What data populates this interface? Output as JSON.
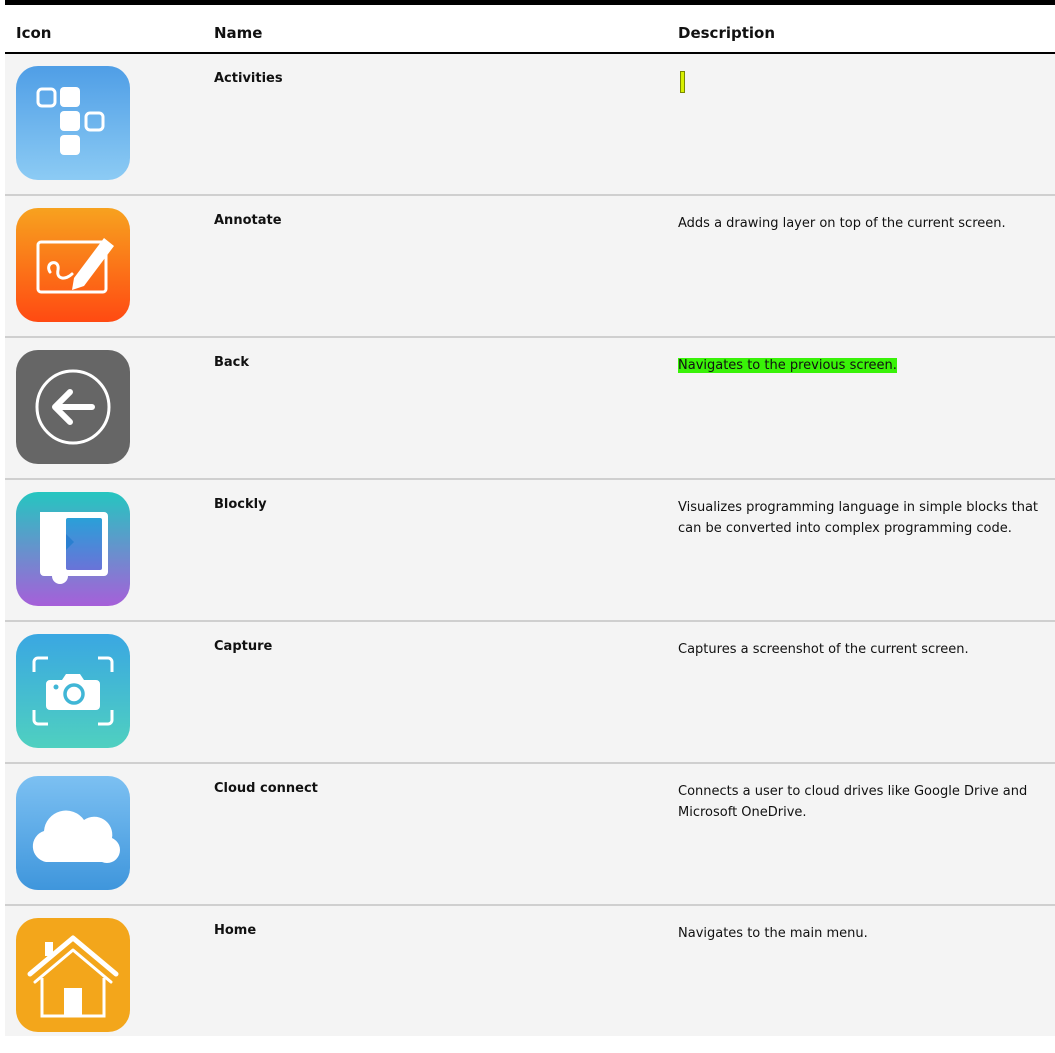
{
  "table": {
    "headers": {
      "icon": "Icon",
      "name": "Name",
      "description": "Description"
    },
    "rows": [
      {
        "name": "Activities",
        "description": "",
        "icon": "activities-icon",
        "color": "#5fb0ea"
      },
      {
        "name": "Annotate",
        "description": "Adds a drawing layer on top of the current screen.",
        "icon": "annotate-icon",
        "color": "#ff5a14"
      },
      {
        "name": "Back",
        "description": "Navigates to the previous screen.",
        "icon": "back-arrow-icon",
        "color": "#666666",
        "highlight": "#39f208"
      },
      {
        "name": "Blockly",
        "description": "Visualizes programming language in simple blocks that can be converted into complex programming code.",
        "icon": "blockly-icon",
        "color": "#7b6fd8"
      },
      {
        "name": "Capture",
        "description": "Captures a screenshot of the current screen.",
        "icon": "camera-icon",
        "color": "#45c2c8"
      },
      {
        "name": "Cloud connect",
        "description": "Connects a user to cloud drives like Google Drive and Microsoft OneDrive.",
        "icon": "cloud-icon",
        "color": "#5aaeea"
      },
      {
        "name": "Home",
        "description": "Navigates to the main menu.",
        "icon": "home-icon",
        "color": "#f3a61b"
      }
    ]
  }
}
